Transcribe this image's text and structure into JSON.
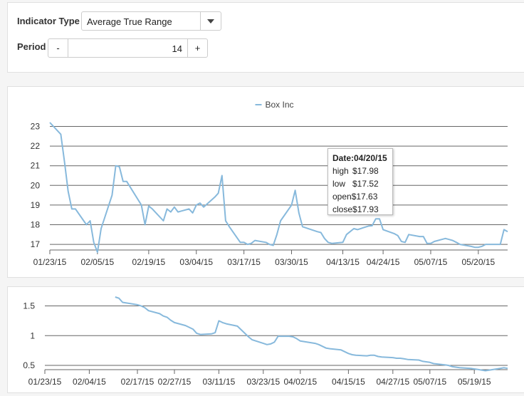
{
  "controls": {
    "indicator_label": "Indicator Type",
    "indicator_value": "Average True Range",
    "period_label": "Period",
    "period_minus": "-",
    "period_value": "14",
    "period_plus": "+"
  },
  "tooltip": {
    "date": "Date:04/20/15",
    "high_label": "high",
    "high": "$17.98",
    "low_label": "low",
    "low": "$17.52",
    "open_label": "open",
    "open": "$17.63",
    "close_label": "close",
    "close": "$17.93"
  },
  "colors": {
    "series": "#87b9dc",
    "grid": "#666666",
    "axis": "#666666"
  },
  "chart_data": [
    {
      "type": "line",
      "legend": [
        "Box Inc"
      ],
      "legend_position": "top-center",
      "grid": true,
      "ylim": [
        16.75,
        23.2
      ],
      "yticks": [
        17,
        18,
        19,
        20,
        21,
        22,
        23
      ],
      "xlim": [
        "01/23/15",
        "05/28/15"
      ],
      "xtick_labels": [
        "01/23/15",
        "02/05/15",
        "02/19/15",
        "03/04/15",
        "03/17/15",
        "03/30/15",
        "04/13/15",
        "04/24/15",
        "05/07/15",
        "05/20/15"
      ],
      "series": [
        {
          "name": "Box Inc",
          "x": [
            "01/23/15",
            "01/26/15",
            "01/27/15",
            "01/28/15",
            "01/29/15",
            "01/30/15",
            "02/02/15",
            "02/03/15",
            "02/04/15",
            "02/05/15",
            "02/06/15",
            "02/09/15",
            "02/10/15",
            "02/11/15",
            "02/12/15",
            "02/13/15",
            "02/17/15",
            "02/18/15",
            "02/19/15",
            "02/20/15",
            "02/23/15",
            "02/24/15",
            "02/25/15",
            "02/26/15",
            "02/27/15",
            "03/02/15",
            "03/03/15",
            "03/04/15",
            "03/05/15",
            "03/06/15",
            "03/09/15",
            "03/10/15",
            "03/11/15",
            "03/12/15",
            "03/13/15",
            "03/16/15",
            "03/17/15",
            "03/18/15",
            "03/19/15",
            "03/20/15",
            "03/23/15",
            "03/24/15",
            "03/25/15",
            "03/26/15",
            "03/27/15",
            "03/30/15",
            "03/31/15",
            "04/01/15",
            "04/02/15",
            "04/06/15",
            "04/07/15",
            "04/08/15",
            "04/09/15",
            "04/10/15",
            "04/13/15",
            "04/14/15",
            "04/15/15",
            "04/16/15",
            "04/17/15",
            "04/20/15",
            "04/21/15",
            "04/22/15",
            "04/23/15",
            "04/24/15",
            "04/27/15",
            "04/28/15",
            "04/29/15",
            "04/30/15",
            "05/01/15",
            "05/04/15",
            "05/05/15",
            "05/06/15",
            "05/07/15",
            "05/08/15",
            "05/11/15",
            "05/12/15",
            "05/13/15",
            "05/14/15",
            "05/15/15",
            "05/18/15",
            "05/19/15",
            "05/20/15",
            "05/21/15",
            "05/22/15",
            "05/26/15",
            "05/27/15",
            "05/28/15"
          ],
          "y": [
            23.2,
            22.6,
            21.2,
            19.7,
            18.8,
            18.8,
            18.0,
            18.2,
            17.1,
            16.6,
            17.8,
            19.5,
            21.0,
            20.95,
            20.2,
            20.2,
            19.0,
            18.0,
            18.95,
            18.8,
            18.2,
            18.8,
            18.65,
            18.9,
            18.65,
            18.8,
            18.6,
            19.0,
            19.1,
            18.9,
            19.4,
            19.6,
            20.5,
            18.2,
            17.9,
            17.1,
            17.1,
            17.0,
            17.05,
            17.2,
            17.1,
            17.0,
            16.95,
            17.5,
            18.2,
            19.0,
            19.75,
            18.6,
            17.9,
            17.65,
            17.6,
            17.3,
            17.1,
            17.05,
            17.1,
            17.5,
            17.65,
            17.8,
            17.75,
            17.93,
            17.95,
            18.3,
            18.3,
            17.75,
            17.55,
            17.45,
            17.15,
            17.1,
            17.5,
            17.4,
            17.4,
            17.05,
            17.05,
            17.15,
            17.3,
            17.25,
            17.2,
            17.1,
            17.0,
            16.9,
            16.85,
            16.85,
            16.9,
            17.0,
            17.0,
            17.75,
            17.65
          ]
        }
      ]
    },
    {
      "type": "line",
      "grid": true,
      "ylim": [
        0.5,
        1.65
      ],
      "yticks": [
        0.5,
        1,
        1.5
      ],
      "xlim": [
        "01/23/15",
        "05/28/15"
      ],
      "xtick_labels": [
        "01/23/15",
        "02/04/15",
        "02/17/15",
        "02/27/15",
        "03/11/15",
        "03/23/15",
        "04/02/15",
        "04/15/15",
        "04/27/15",
        "05/07/15",
        "05/19/15"
      ],
      "series": [
        {
          "x": [
            "02/11/15",
            "02/12/15",
            "02/13/15",
            "02/17/15",
            "02/18/15",
            "02/19/15",
            "02/20/15",
            "02/23/15",
            "02/24/15",
            "02/25/15",
            "02/26/15",
            "02/27/15",
            "03/02/15",
            "03/03/15",
            "03/04/15",
            "03/05/15",
            "03/06/15",
            "03/09/15",
            "03/10/15",
            "03/11/15",
            "03/12/15",
            "03/13/15",
            "03/16/15",
            "03/17/15",
            "03/18/15",
            "03/19/15",
            "03/20/15",
            "03/23/15",
            "03/24/15",
            "03/25/15",
            "03/26/15",
            "03/27/15",
            "03/30/15",
            "03/31/15",
            "04/01/15",
            "04/02/15",
            "04/06/15",
            "04/07/15",
            "04/08/15",
            "04/09/15",
            "04/10/15",
            "04/13/15",
            "04/14/15",
            "04/15/15",
            "04/16/15",
            "04/17/15",
            "04/20/15",
            "04/21/15",
            "04/22/15",
            "04/23/15",
            "04/24/15",
            "04/27/15",
            "04/28/15",
            "04/29/15",
            "04/30/15",
            "05/01/15",
            "05/04/15",
            "05/05/15",
            "05/06/15",
            "05/07/15",
            "05/08/15",
            "05/11/15",
            "05/12/15",
            "05/13/15",
            "05/14/15",
            "05/15/15",
            "05/18/15",
            "05/19/15",
            "05/20/15",
            "05/21/15",
            "05/22/15",
            "05/26/15",
            "05/27/15",
            "05/28/15"
          ],
          "y": [
            1.65,
            1.63,
            1.56,
            1.52,
            1.5,
            1.47,
            1.42,
            1.37,
            1.33,
            1.31,
            1.26,
            1.22,
            1.17,
            1.14,
            1.11,
            1.04,
            1.02,
            1.03,
            1.05,
            1.25,
            1.22,
            1.2,
            1.16,
            1.1,
            1.04,
            0.98,
            0.93,
            0.87,
            0.85,
            0.86,
            0.89,
            0.99,
            0.99,
            0.98,
            0.95,
            0.91,
            0.87,
            0.85,
            0.82,
            0.79,
            0.78,
            0.76,
            0.73,
            0.7,
            0.68,
            0.67,
            0.66,
            0.67,
            0.67,
            0.65,
            0.64,
            0.63,
            0.62,
            0.62,
            0.61,
            0.6,
            0.59,
            0.57,
            0.56,
            0.55,
            0.53,
            0.51,
            0.5,
            0.48,
            0.47,
            0.46,
            0.45,
            0.44,
            0.43,
            0.42,
            0.41,
            0.45,
            0.46,
            0.45
          ]
        }
      ]
    }
  ]
}
